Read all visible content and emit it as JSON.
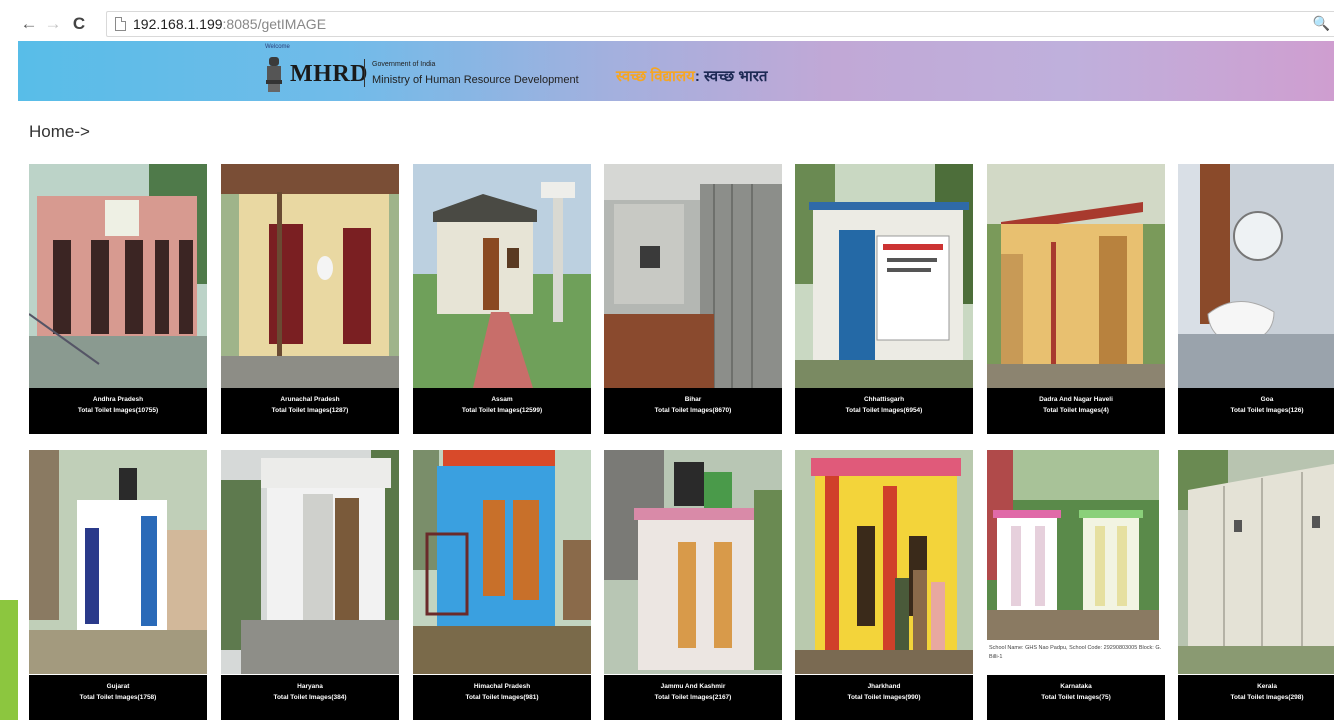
{
  "browser": {
    "back_icon": "←",
    "forward_icon": "→",
    "reload_icon": "C",
    "zoom_icon": "🔍",
    "url_host": "192.168.1.199",
    "url_rest": ":8085/getIMAGE"
  },
  "banner": {
    "welcome": "Welcome",
    "logo_text": "MHRD",
    "gov_text": "Government of India",
    "ministry_text": "Ministry of Human Resource Development",
    "swachh_part1": "स्वच्छ विद्यालय",
    "swachh_part2": ": स्वच्छ भारत"
  },
  "breadcrumb": "Home->",
  "colors": {
    "banner_start": "#58bde8",
    "banner_end": "#cf9ed0",
    "label_bg": "#000000",
    "accent_green": "#8cc63f"
  },
  "cards": [
    {
      "state": "Andhra Pradesh",
      "count": "Total Toilet Images(10755)"
    },
    {
      "state": "Arunachal Pradesh",
      "count": "Total Toilet Images(1287)"
    },
    {
      "state": "Assam",
      "count": "Total Toilet Images(12599)"
    },
    {
      "state": "Bihar",
      "count": "Total Toilet Images(8670)"
    },
    {
      "state": "Chhattisgarh",
      "count": "Total Toilet Images(6954)"
    },
    {
      "state": "Dadra And Nagar Haveli",
      "count": "Total Toilet Images(4)"
    },
    {
      "state": "Goa",
      "count": "Total Toilet Images(126)"
    },
    {
      "state": "Gujarat",
      "count": "Total Toilet Images(1758)"
    },
    {
      "state": "Haryana",
      "count": "Total Toilet Images(384)"
    },
    {
      "state": "Himachal Pradesh",
      "count": "Total Toilet Images(981)"
    },
    {
      "state": "Jammu And Kashmir",
      "count": "Total Toilet Images(2167)"
    },
    {
      "state": "Jharkhand",
      "count": "Total Toilet Images(990)"
    },
    {
      "state": "Karnataka",
      "count": "Total Toilet Images(75)"
    },
    {
      "state": "Kerala",
      "count": "Total Toilet Images(298)"
    }
  ],
  "karnataka_caption": "School Name: GHS Nao Padpu, School Code: 29290803005 Block: G. Billi-1"
}
